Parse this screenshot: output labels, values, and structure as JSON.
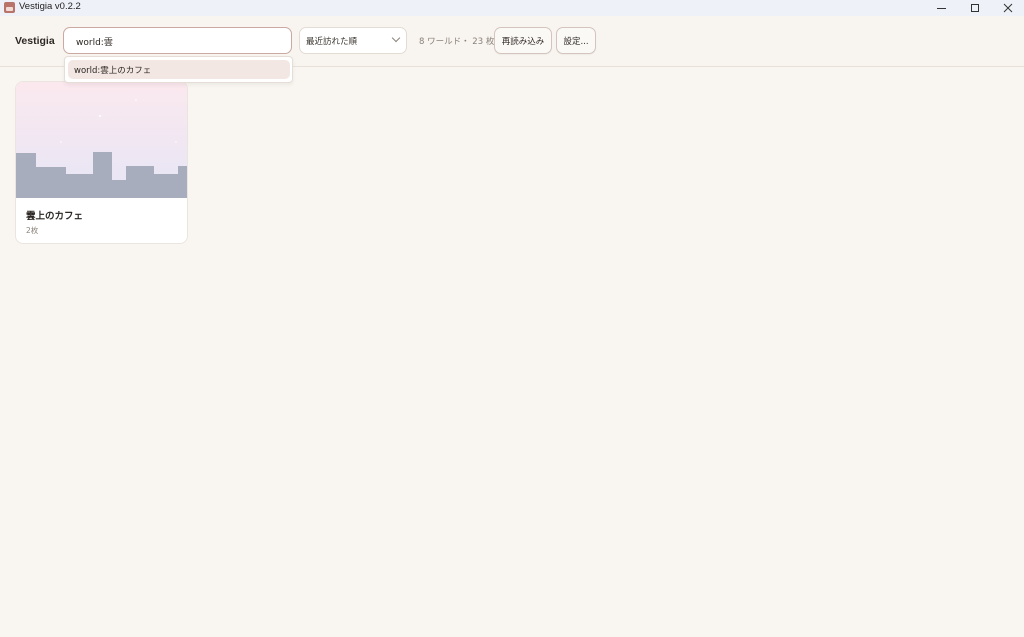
{
  "window": {
    "title": "Vestigia v0.2.2"
  },
  "toolbar": {
    "brand": "Vestigia",
    "search_value": "world:雲",
    "sort_selected": "最近訪れた順",
    "stats": "8 ワールド・ 23 枚",
    "reload_label": "再読み込み",
    "settings_label": "設定..."
  },
  "suggestions": [
    {
      "label": "world:雲上のカフェ"
    }
  ],
  "cards": [
    {
      "title": "雲上のカフェ",
      "count": "2枚"
    }
  ],
  "colors": {
    "background": "#f9f6f1",
    "accent_border": "#c9a9a2",
    "suggest_highlight": "#f3e7e3",
    "skyline": "#a8adbd"
  },
  "icons": {
    "app": "vestigia-app-icon",
    "minimize": "minimize-icon",
    "maximize": "maximize-icon",
    "close": "close-icon",
    "sort_dropdown": "chevron-down-icon"
  }
}
